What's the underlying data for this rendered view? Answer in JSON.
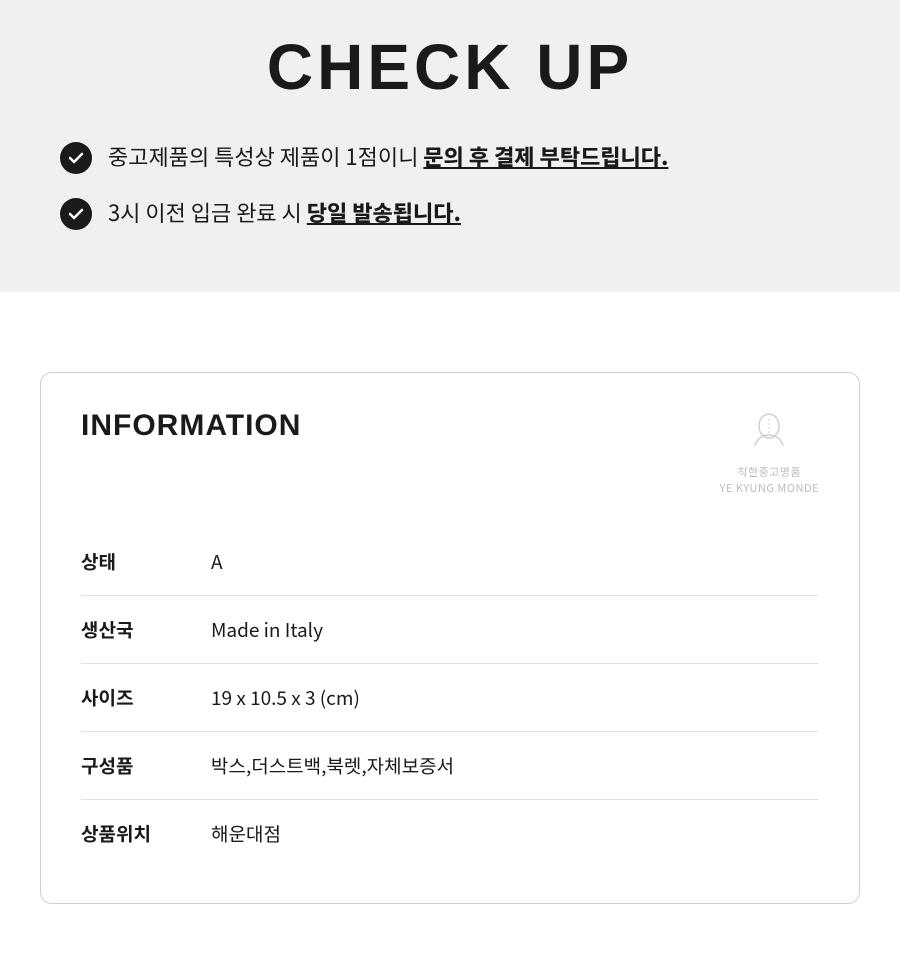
{
  "header": {
    "title": "CHECK UP"
  },
  "checklist": {
    "items": [
      {
        "text_before": "중고제품의 특성상 제품이 1점이니 ",
        "text_bold": "문의 후 결제 부탁드립니다.",
        "id": "item-1"
      },
      {
        "text_before": "3시 이전 입금 완료 시 ",
        "text_bold": "당일 발송됩니다.",
        "id": "item-2"
      }
    ]
  },
  "info_section": {
    "title": "INFORMATION",
    "brand_name": "착한중고명품",
    "brand_sub": "YE KYUNG MONDE",
    "rows": [
      {
        "label": "상태",
        "value": "A"
      },
      {
        "label": "생산국",
        "value": "Made in Italy"
      },
      {
        "label": "사이즈",
        "value": "19 x 10.5 x 3 (cm)"
      },
      {
        "label": "구성품",
        "value": "박스,더스트백,북렛,자체보증서"
      },
      {
        "label": "상품위치",
        "value": "해운대점"
      }
    ]
  }
}
